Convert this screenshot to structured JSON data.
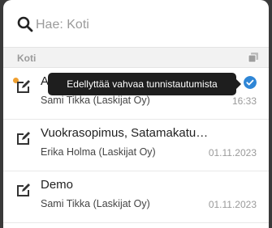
{
  "search": {
    "placeholder": "Hae: Koti",
    "icon": "search-icon"
  },
  "section": {
    "label": "Koti",
    "icon": "stack-icon"
  },
  "tooltip": {
    "text": "Edellyttää vahvaa tunnistautumista"
  },
  "items": [
    {
      "title": "Au",
      "subtitle": "Sami Tikka (Laskijat Oy)",
      "date": "16:33",
      "unread": true,
      "strong_auth": true,
      "icon": "edit-icon"
    },
    {
      "title": "Vuokrasopimus, Satamakatu…",
      "subtitle": "Erika Holma (Laskijat Oy)",
      "date": "01.11.2023",
      "icon": "edit-icon"
    },
    {
      "title": "Demo",
      "subtitle": "Sami Tikka (Laskijat Oy)",
      "date": "01.11.2023",
      "icon": "edit-icon"
    }
  ],
  "colors": {
    "accent": "#2f86d6",
    "unread_dot": "#f0a030",
    "tooltip_bg": "#1e1e1e"
  }
}
